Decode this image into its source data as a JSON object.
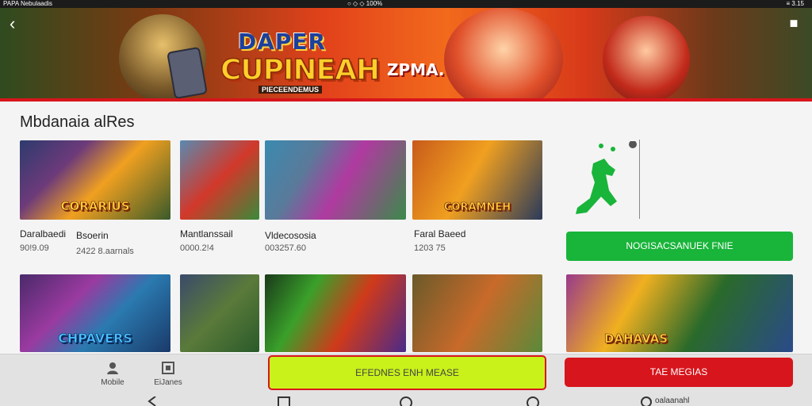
{
  "status_bar": {
    "left": "PAPA Nebulaadis",
    "center": "○ ◇ ◇ 100%",
    "right": "≡ 3.15"
  },
  "banner": {
    "logo_line1": "DAPER",
    "logo_line2": "CUPINEAH",
    "logo_tagline": "PIECEENDEMUS",
    "promo_text": "ZPMA."
  },
  "section": {
    "title": "Mbdanaia alRes"
  },
  "row1": [
    {
      "caption": "CORARIUS",
      "name": "Daralbaedi",
      "meta": "90!9.09"
    },
    {
      "caption": "",
      "name": "Bsoerin",
      "meta": "2422 8.aarnals"
    },
    {
      "caption": "",
      "name": "Mantlanssail",
      "meta": "0000.2!4"
    },
    {
      "caption": "",
      "name": "Vldecososia",
      "meta": "003257.60"
    },
    {
      "caption": "CORAMNEH",
      "name": "Faral Baeed",
      "meta": "1203 75"
    }
  ],
  "row2": [
    {
      "caption": "CHPAVERS"
    },
    {
      "caption": ""
    },
    {
      "caption": ""
    },
    {
      "caption": ""
    },
    {
      "caption": "DAHAVAS"
    }
  ],
  "buttons": {
    "green": "NOGISACSANUEK FNIE",
    "yellow": "EFEDNES ENH MEASE",
    "red": "TAE MEGIAS"
  },
  "bottom_nav": {
    "item1": "Mobile",
    "item2": "EiJanes",
    "sys_label": "oalaanahl"
  },
  "colors": {
    "accent_red": "#d7151c",
    "accent_green": "#19b43a",
    "accent_yellow": "#c8f21a"
  }
}
